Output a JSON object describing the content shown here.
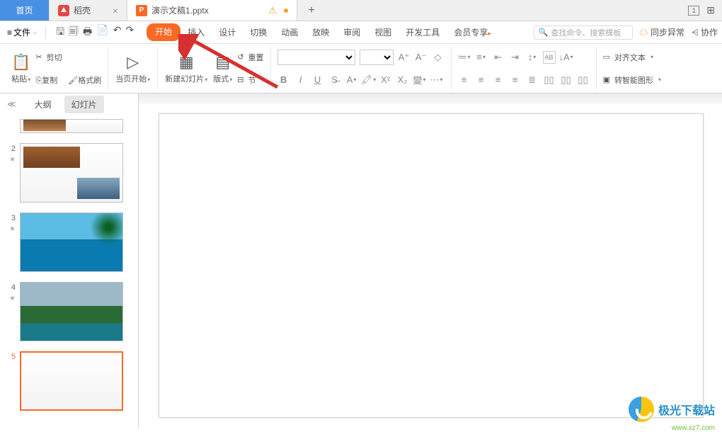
{
  "tabs": {
    "home": "首页",
    "docer": "稻壳",
    "file": "演示文稿1.pptx",
    "plus": "+"
  },
  "menubar": {
    "file_label": "文件",
    "tabs": {
      "start": "开始",
      "insert": "插入",
      "design": "设计",
      "transition": "切换",
      "anim": "动画",
      "show": "放映",
      "review": "审阅",
      "view": "视图",
      "dev": "开发工具",
      "member": "会员专享"
    },
    "search_placeholder": "查找命令、搜索模板",
    "sync": "同步异常",
    "coop": "协作"
  },
  "ribbon": {
    "paste": "粘贴",
    "cut": "剪切",
    "copy": "复制",
    "format_painter": "格式刷",
    "from_current": "当页开始",
    "new_slide": "新建幻灯片",
    "layout": "版式",
    "reset": "重置",
    "section": "节",
    "align_text": "对齐文本",
    "smart_shape": "转智能图形",
    "ab_label": "AB"
  },
  "sidebar": {
    "outline": "大纲",
    "slides": "幻灯片",
    "nums": [
      "2",
      "3",
      "4",
      "5"
    ]
  },
  "watermark": {
    "title": "极光下载站",
    "url": "www.xz7.com"
  }
}
